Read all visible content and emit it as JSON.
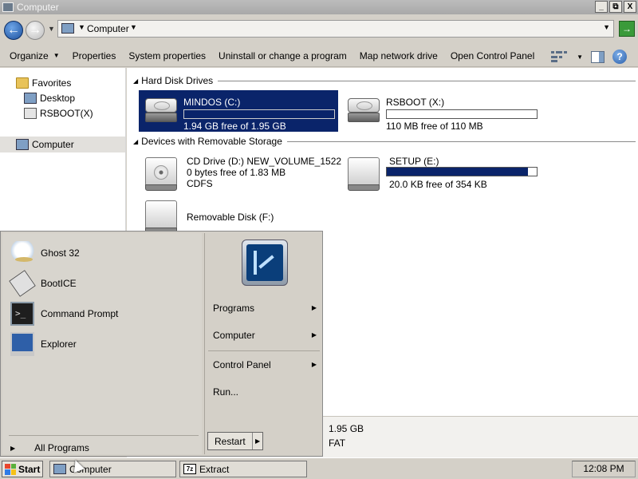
{
  "window": {
    "title": "Computer",
    "buttons": [
      "_",
      "⧉",
      "X"
    ]
  },
  "address": {
    "location": "Computer",
    "go_label": "→"
  },
  "toolbar": {
    "items": [
      "Organize",
      "Properties",
      "System properties",
      "Uninstall or change a program",
      "Map network drive",
      "Open Control Panel"
    ],
    "help_label": "?"
  },
  "nav": {
    "favorites": "Favorites",
    "desktop": "Desktop",
    "rsboot": "RSBOOT(X)",
    "computer": "Computer"
  },
  "groups": {
    "hard_disks": "Hard Disk Drives",
    "removable": "Devices with Removable Storage"
  },
  "drives": {
    "mindos": {
      "name": "MINDOS (C:)",
      "free": "1.94 GB free of 1.95 GB",
      "used_fraction": 0.005
    },
    "rsboot": {
      "name": "RSBOOT (X:)",
      "free": "110 MB free of 110 MB",
      "used_fraction": 0.0
    },
    "cd": {
      "name": "CD Drive (D:) NEW_VOLUME_1522",
      "free": "0 bytes free of 1.83 MB",
      "fs": "CDFS"
    },
    "setup": {
      "name": "SETUP (E:)",
      "free": "20.0 KB free of 354 KB",
      "used_fraction": 0.94
    },
    "removable": {
      "name": "Removable Disk (F:)"
    }
  },
  "details": {
    "size": "1.95 GB",
    "fs": "FAT"
  },
  "start_menu": {
    "left_items": [
      {
        "label": "Ghost 32",
        "icon": "ghost-icon"
      },
      {
        "label": "BootICE",
        "icon": "bootice-icon"
      },
      {
        "label": "Command Prompt",
        "icon": "command-prompt-icon"
      },
      {
        "label": "Explorer",
        "icon": "explorer-icon"
      }
    ],
    "all_programs": "All Programs",
    "right_items": [
      "Programs",
      "Computer",
      "Control Panel",
      "Run..."
    ],
    "restart": "Restart"
  },
  "taskbar": {
    "start": "Start",
    "tasks": [
      "Computer",
      "Extract"
    ],
    "task_icon_7z": "7z",
    "clock": "12:08 PM"
  },
  "colors": {
    "selection": "#0a246a",
    "window_bg": "#d4d0c8"
  }
}
